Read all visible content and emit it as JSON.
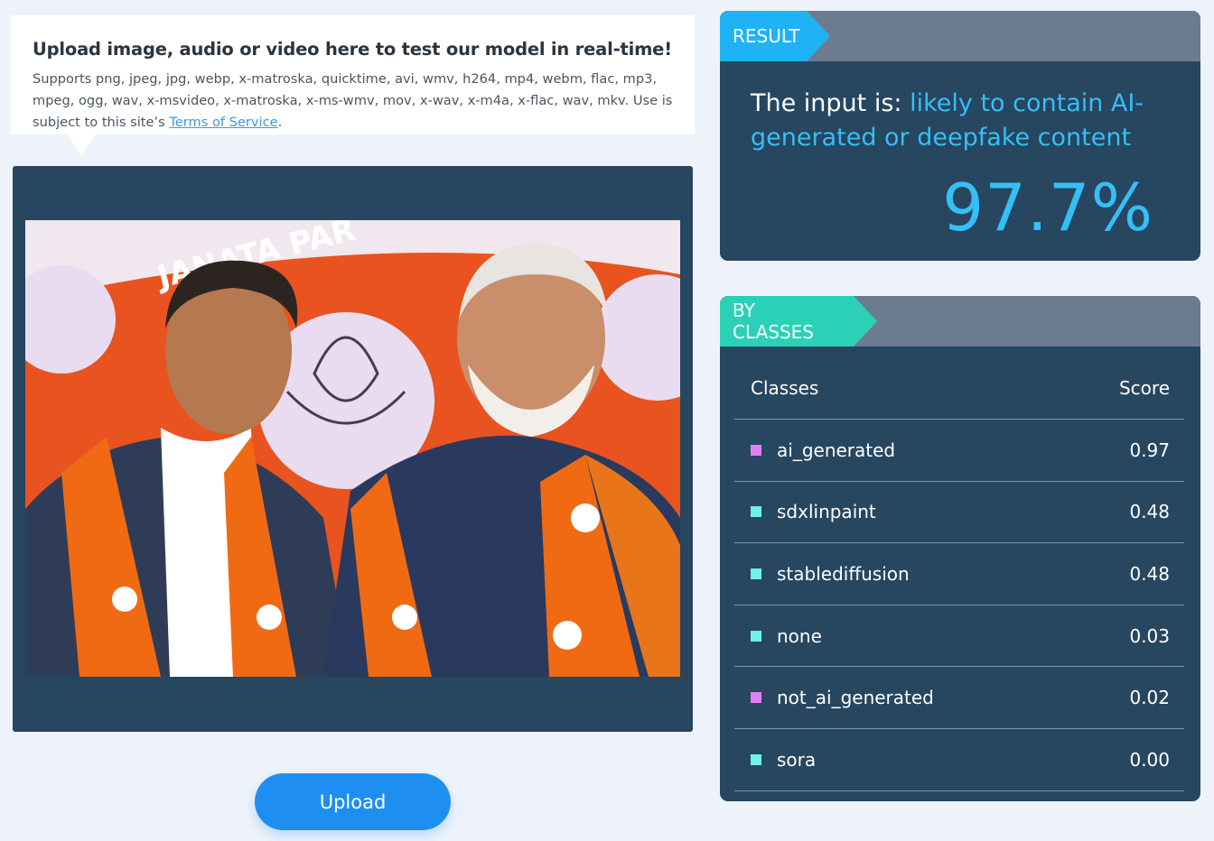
{
  "info": {
    "title": "Upload image, audio or video here to test our model in real-time!",
    "description": "Supports png, jpeg, jpg, webp, x-matroska, quicktime, avi, wmv, h264, mp4, webm, flac, mp3, mpeg, ogg, wav, x-msvideo, x-matroska, x-ms-wmv, mov, x-wav, x-m4a, x-flac, wav, mkv. Use is subject to this site’s ",
    "terms_link": "Terms of Service",
    "terms_suffix": "."
  },
  "image": {
    "alt": "Uploaded photo of two men wearing orange scarves in front of an orange banner",
    "banner_text": "JANATA PAR"
  },
  "upload_button": {
    "label": "Upload"
  },
  "result": {
    "tag": "RESULT",
    "prefix": "The input is: ",
    "verdict": "likely to contain AI-generated or deepfake content",
    "percent": "97.7%",
    "accent": "#35bff7"
  },
  "classes": {
    "tag": "BY CLASSES",
    "col_class": "Classes",
    "col_score": "Score",
    "rows": [
      {
        "name": "ai_generated",
        "score": "0.97",
        "color": "#e57ef3"
      },
      {
        "name": "sdxlinpaint",
        "score": "0.48",
        "color": "#6ff0ea"
      },
      {
        "name": "stablediffusion",
        "score": "0.48",
        "color": "#6ff0ea"
      },
      {
        "name": "none",
        "score": "0.03",
        "color": "#6ff0ea"
      },
      {
        "name": "not_ai_generated",
        "score": "0.02",
        "color": "#e57ef3"
      },
      {
        "name": "sora",
        "score": "0.00",
        "color": "#6ff0ea"
      }
    ]
  }
}
